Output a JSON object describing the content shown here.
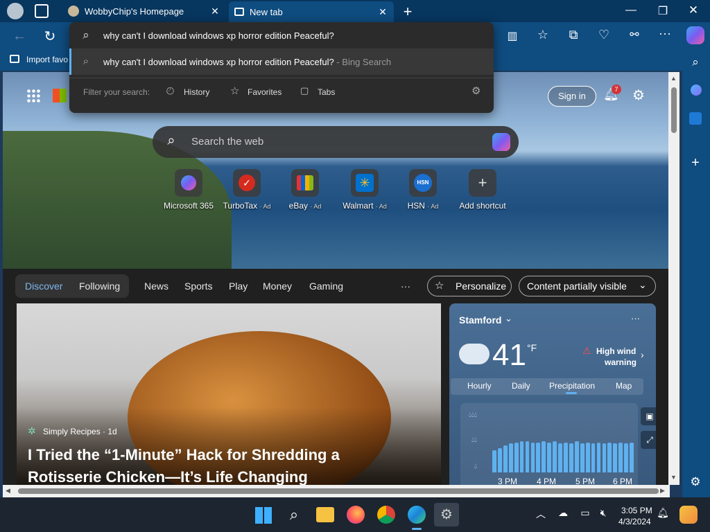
{
  "tabs": [
    {
      "label": "WobbyChip's Homepage"
    },
    {
      "label": "New tab"
    }
  ],
  "omnibox": {
    "value": "why can't I download windows xp horror edition Peaceful?",
    "suggestion": "why can't I download windows xp horror edition Peaceful?",
    "suggestion_suffix": " - Bing Search",
    "filter_label": "Filter your search:",
    "filters": [
      "History",
      "Favorites",
      "Tabs"
    ]
  },
  "favbar": {
    "import_label": "Import favo"
  },
  "header": {
    "sign_in": "Sign in",
    "notif_count": "7"
  },
  "search": {
    "placeholder": "Search the web"
  },
  "shortcuts": [
    {
      "name": "Microsoft 365",
      "ad": ""
    },
    {
      "name": "TurboTax",
      "ad": "· Ad"
    },
    {
      "name": "eBay",
      "ad": "· Ad"
    },
    {
      "name": "Walmart",
      "ad": "· Ad"
    },
    {
      "name": "HSN",
      "ad": "· Ad",
      "tile_text": "HSN"
    },
    {
      "name": "Add shortcut",
      "ad": ""
    }
  ],
  "feed": {
    "tabs": [
      "Discover",
      "Following",
      "News",
      "Sports",
      "Play",
      "Money",
      "Gaming"
    ],
    "more": "···",
    "personalize": "Personalize",
    "visibility": "Content partially visible",
    "article": {
      "source": "Simply Recipes · 1d",
      "title_line1": "I Tried the “1-Minute” Hack for Shredding a",
      "title_line2": "Rotisserie Chicken—It’s Life Changing"
    }
  },
  "weather": {
    "city": "Stamford",
    "temp": "41",
    "unit": "°F",
    "alert_line1": "High wind",
    "alert_line2": "warning",
    "tabs": [
      "Hourly",
      "Daily",
      "Precipitation",
      "Map"
    ],
    "times": [
      "3 PM",
      "4 PM",
      "5 PM",
      "6 PM"
    ],
    "bars": [
      0.45,
      0.5,
      0.55,
      0.6,
      0.62,
      0.64,
      0.64,
      0.62,
      0.62,
      0.64,
      0.62,
      0.64,
      0.6,
      0.62,
      0.6,
      0.64,
      0.6,
      0.62,
      0.6,
      0.62,
      0.6,
      0.62,
      0.6,
      0.62,
      0.6,
      0.62
    ]
  },
  "tray": {
    "time": "3:05 PM",
    "date": "4/3/2024"
  },
  "colors": {
    "accent": "#0f4c80",
    "bar": "#5fb1f0",
    "notif": "#d13438"
  }
}
